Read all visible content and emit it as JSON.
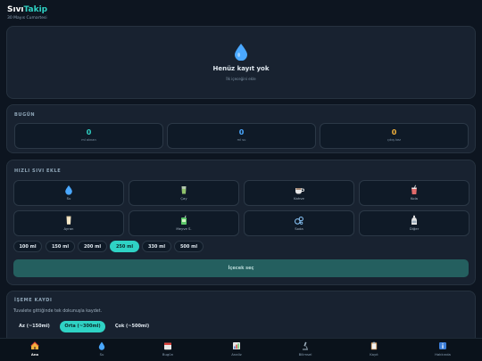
{
  "header": {
    "brand_a": "Sıvı",
    "brand_b": "Takip",
    "date": "30 Mayıs Cumartesi"
  },
  "hero": {
    "title": "Henüz kayıt yok",
    "subtitle": "İlk içeceğini ekle"
  },
  "today": {
    "title": "BUGÜN",
    "stats": [
      {
        "value": "0",
        "label": "ml alınan",
        "color": "#2fd2c4"
      },
      {
        "value": "0",
        "label": "ml su",
        "color": "#4aa8ff"
      },
      {
        "value": "0",
        "label": "çıkış kez",
        "color": "#f2b13c"
      }
    ]
  },
  "quick": {
    "title": "HIZLI SIVI EKLE",
    "drinks": [
      "Su",
      "Çay",
      "Kahve",
      "Kola",
      "Ayran",
      "Meyve S.",
      "Soda",
      "Diğer"
    ],
    "sizes": [
      "100 ml",
      "150 ml",
      "200 ml",
      "250 ml",
      "330 ml",
      "500 ml"
    ],
    "selected_size": "250 ml",
    "select_button": "İçecek seç"
  },
  "log": {
    "title": "İŞEME KAYDI",
    "hint": "Tuvalete gittiğinde tek dokunuşla kaydet.",
    "options": [
      "Az (~150ml)",
      "Orta (~300ml)",
      "Çok (~500ml)"
    ],
    "selected": "Orta (~300ml)"
  },
  "nav": {
    "items": [
      {
        "label": "Ana",
        "icon": "home-icon"
      },
      {
        "label": "Su",
        "icon": "water-drop-icon"
      },
      {
        "label": "Bugün",
        "icon": "calendar-icon"
      },
      {
        "label": "Analiz",
        "icon": "chart-icon"
      },
      {
        "label": "Bilimsel",
        "icon": "microscope-icon"
      },
      {
        "label": "Kayıt",
        "icon": "clipboard-icon"
      },
      {
        "label": "Hakkında",
        "icon": "info-icon"
      }
    ],
    "active": "Ana"
  },
  "colors": {
    "accent": "#2fd2c4",
    "background": "#0d1520",
    "card": "#182230",
    "water": "#4aa8ff",
    "warning": "#f2b13c"
  }
}
